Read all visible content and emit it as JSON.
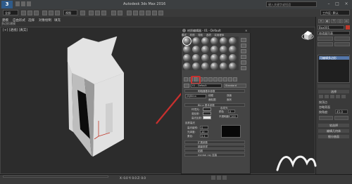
{
  "window": {
    "title": "Autodesk 3ds Max 2016",
    "search_placeholder": "键入关键字或短语",
    "app_logo": "3"
  },
  "toolbar": {
    "workspace": "工作区: 默认",
    "selection_filter": "全部",
    "view_dropdown": "视图"
  },
  "ribbon": {
    "tabs": [
      "建模",
      "自由形式",
      "选择",
      "对象绘制",
      "填充"
    ],
    "sub_label": "多边形建模"
  },
  "viewport": {
    "label": "[+] [透视] [真实]"
  },
  "material_editor": {
    "title": "材质编辑器 - 01 - Default",
    "menu": [
      "模式",
      "材质",
      "导航",
      "选项",
      "实用程序"
    ],
    "material_name": "01 - Default",
    "material_type": "Standard",
    "shader_header": "明暗器基本参数",
    "shader": "(B)Blinn",
    "options": [
      "线框",
      "双面",
      "面贴图",
      "面状"
    ],
    "blinn_header": "Blinn 基本参数",
    "labels": {
      "ambient": "环境光:",
      "diffuse": "漫反射:",
      "specular": "高光反射:",
      "self_illum": "自发光",
      "color": "颜色",
      "opacity": "不透明度:",
      "spec_highlights": "反射高光",
      "spec_level": "高光级别:",
      "glossiness": "光泽度:",
      "soften": "柔化:"
    },
    "values": {
      "self_illum": "0",
      "opacity": "100",
      "spec_level": "0",
      "glossiness": "10",
      "soften": "0.1"
    },
    "rollouts": [
      "扩展参数",
      "超级采样",
      "贴图",
      "mental ray 连接"
    ]
  },
  "command_panel": {
    "object_name": "Box001",
    "modifier_list": "修改器列表",
    "stack_item": "可编辑多边形",
    "sections": [
      "选择",
      "软选择",
      "编辑几何体",
      "细分曲面"
    ],
    "checkbox_labels": [
      "按顶点",
      "忽略背面",
      "按角度:"
    ],
    "angle_value": "45.0"
  },
  "status": {
    "coordinates": "X: 0.0 Y: 0.0 Z: 0.0"
  },
  "colors": {
    "accent_red": "#c8302e",
    "viewport_bg": "#2c2c2c",
    "ui_bg": "#3a3a3a"
  },
  "icons": [
    "app-logo-icon",
    "rotate-icon",
    "view-cube-icon",
    "material-sphere-icon",
    "assign-material-icon"
  ]
}
